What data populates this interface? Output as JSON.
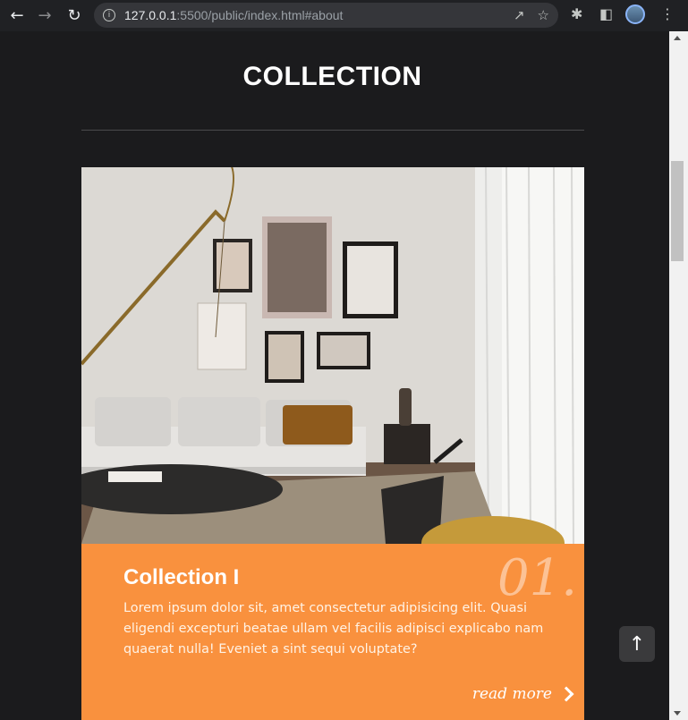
{
  "browser": {
    "url_host": "127.0.0.1",
    "url_rest": ":5500/public/index.html#about"
  },
  "page": {
    "section_title": "COLLECTION"
  },
  "card": {
    "number": "01.",
    "title": "Collection I",
    "text": "Lorem ipsum dolor sit, amet consectetur adipisicing elit. Quasi eligendi excepturi beatae ullam vel facilis adipisci explicabo nam quaerat nulla! Eveniet a sint sequi voluptate?",
    "read_more": "read more",
    "accent_color": "#f9913e"
  },
  "icons": [
    "back-icon",
    "forward-icon",
    "reload-icon",
    "info-icon",
    "share-icon",
    "star-icon",
    "extensions-icon",
    "side-panel-icon",
    "menu-icon",
    "arrow-up-icon",
    "chevron-right-icon"
  ]
}
